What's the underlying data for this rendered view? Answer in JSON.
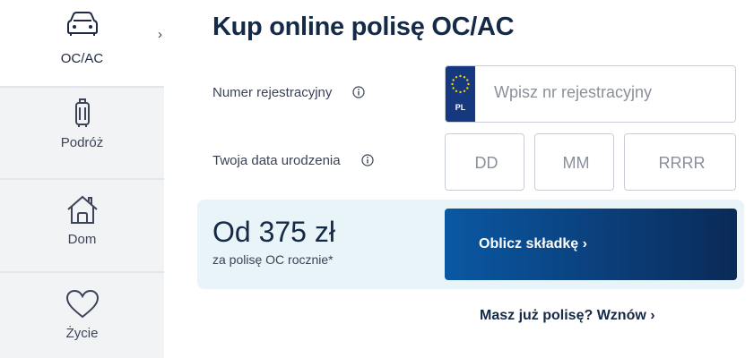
{
  "sidebar": {
    "items": [
      {
        "label": "OC/AC",
        "icon": "car-icon",
        "active": true
      },
      {
        "label": "Podróż",
        "icon": "suitcase-icon",
        "active": false
      },
      {
        "label": "Dom",
        "icon": "house-icon",
        "active": false
      },
      {
        "label": "Życie",
        "icon": "heart-icon",
        "active": false
      }
    ],
    "expand_icon": "chevron-right-icon"
  },
  "main": {
    "title": "Kup online polisę OC/AC",
    "registration": {
      "label": "Numer rejestracyjny",
      "placeholder": "Wpisz nr rejestracyjny",
      "country_code": "PL"
    },
    "birthdate": {
      "label": "Twoja data urodzenia",
      "day_placeholder": "DD",
      "month_placeholder": "MM",
      "year_placeholder": "RRRR"
    },
    "promo": {
      "price": "Od 375 zł",
      "price_note": "za polisę OC rocznie*",
      "cta_label": "Oblicz składkę ›"
    },
    "renew_link": "Masz już polisę? Wznów ›"
  },
  "colors": {
    "brand_dark": "#152a47",
    "cta_start": "#0a58a3",
    "cta_end": "#0a2a57",
    "promo_bg": "#e9f4f8",
    "eu_blue": "#15387f",
    "sidebar_inactive": "#f2f3f5"
  }
}
